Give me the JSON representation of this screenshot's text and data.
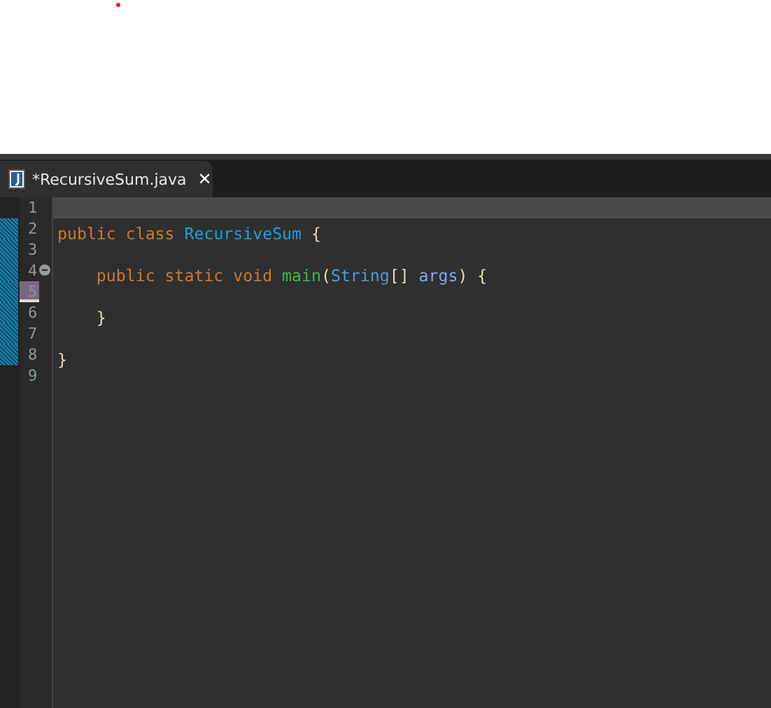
{
  "tab": {
    "title": "*RecursiveSum.java",
    "close": "✕"
  },
  "lines": [
    {
      "number": "1",
      "current": true,
      "changed": false,
      "fold": false,
      "marked": false
    },
    {
      "number": "2",
      "current": false,
      "changed": true,
      "fold": false,
      "marked": false,
      "tokens": [
        {
          "text": "public class ",
          "kind": "keyword"
        },
        {
          "text": "RecursiveSum",
          "kind": "class"
        },
        {
          "text": " {",
          "kind": "brace"
        }
      ]
    },
    {
      "number": "3",
      "current": false,
      "changed": true,
      "fold": false,
      "marked": false
    },
    {
      "number": "4",
      "current": false,
      "changed": true,
      "fold": true,
      "marked": false,
      "tokens": [
        {
          "text": "    public static void ",
          "kind": "keyword"
        },
        {
          "text": "main",
          "kind": "method"
        },
        {
          "text": "(",
          "kind": "brace"
        },
        {
          "text": "String",
          "kind": "type"
        },
        {
          "text": "[] ",
          "kind": "brace"
        },
        {
          "text": "args",
          "kind": "param"
        },
        {
          "text": ") {",
          "kind": "brace"
        }
      ]
    },
    {
      "number": "5",
      "current": false,
      "changed": true,
      "fold": false,
      "marked": true
    },
    {
      "number": "6",
      "current": false,
      "changed": true,
      "fold": false,
      "marked": false,
      "tokens": [
        {
          "text": "    }",
          "kind": "brace"
        }
      ]
    },
    {
      "number": "7",
      "current": false,
      "changed": true,
      "fold": false,
      "marked": false
    },
    {
      "number": "8",
      "current": false,
      "changed": true,
      "fold": false,
      "marked": false,
      "tokens": [
        {
          "text": "}",
          "kind": "brace"
        }
      ]
    },
    {
      "number": "9",
      "current": false,
      "changed": false,
      "fold": false,
      "marked": false
    }
  ]
}
